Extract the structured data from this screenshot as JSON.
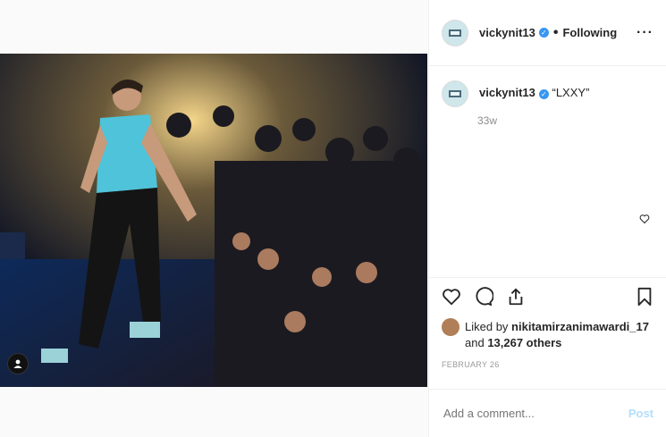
{
  "post": {
    "username": "vickynit13",
    "follow_status": "Following",
    "more_icon": "more-options-icon",
    "caption": "“LXXY”",
    "time_ago": "33w",
    "likes_prefix": "Liked by ",
    "liker": "nikitamirzanimawardi_17",
    "likes_mid": " and ",
    "likes_count": "13,267 others",
    "date": "FEBRUARY 26",
    "comment_placeholder": "Add a comment...",
    "post_label": "Post",
    "verified_color": "#3897f0",
    "icons": [
      "heart-icon",
      "comment-icon",
      "share-icon",
      "bookmark-icon",
      "user-tag-icon"
    ]
  }
}
